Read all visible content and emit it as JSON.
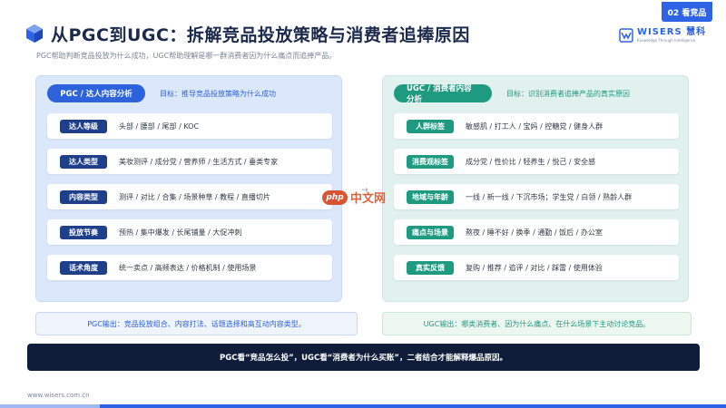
{
  "header": {
    "title": "从PGC到UGC：拆解竞品投放策略与消费者追捧原因",
    "subtitle": "PGC帮助判断竞品投放为什么成功，UGC帮助理解是哪一群消费者因为什么痛点而追捧产品。",
    "badge": "02 看竞品",
    "logo_main": "WISERS 慧科",
    "logo_sub": "Knowledge Through Intelligence"
  },
  "left_panel": {
    "title": "PGC / 达人内容分析",
    "goal": "目标：推导竞品投放策略为什么成功",
    "rows": [
      {
        "tag": "达人等级",
        "text": "头部 / 腰部 / 尾部 / KOC"
      },
      {
        "tag": "达人类型",
        "text": "美妆测评 / 成分党 / 营养师 / 生活方式 / 垂类专家"
      },
      {
        "tag": "内容类型",
        "text": "测评 / 对比 / 合集 / 场景种草 / 教程 / 直播切片"
      },
      {
        "tag": "投放节奏",
        "text": "预热 / 集中爆发 / 长尾铺量 / 大促冲刺"
      },
      {
        "tag": "话术角度",
        "text": "统一卖点 / 高频表达 / 价格机制 / 使用场景"
      }
    ],
    "output": "PGC输出：竞品投放组合、内容打法、话题选择和高互动内容类型。"
  },
  "right_panel": {
    "title": "UGC / 消费者内容分析",
    "goal": "目标：识别消费者追捧产品的真实原因",
    "rows": [
      {
        "tag": "人群标签",
        "text": "敏感肌 / 打工人 / 宝妈 / 控糖党 / 健身人群"
      },
      {
        "tag": "消费观标签",
        "text": "成分党 / 性价比 / 轻养生 / 悦己 / 安全感"
      },
      {
        "tag": "地域与年龄",
        "text": "一线 / 新一线 / 下沉市场；学生党 / 白领 / 熟龄人群"
      },
      {
        "tag": "痛点与场景",
        "text": "熬夜 / 睡不好 / 换季 / 通勤 / 饭后 / 办公室"
      },
      {
        "tag": "真实反馈",
        "text": "复购 / 推荐 / 追评 / 对比 / 踩雷 / 使用体验"
      }
    ],
    "output": "UGC输出：哪类消费者、因为什么痛点、在什么场景下主动讨论竞品。"
  },
  "arrow": "→",
  "summary": "PGC看“竞品怎么投”，UGC看“消费者为什么买账”，二者结合才能解释爆品原因。",
  "footer": {
    "url": "www.wisers.com.cn"
  },
  "watermark": {
    "logo": "php",
    "text": "中文网"
  },
  "colors": {
    "primary_blue": "#2d62dd",
    "primary_green": "#1e9a80",
    "dark_navy": "#0f1d3a"
  }
}
